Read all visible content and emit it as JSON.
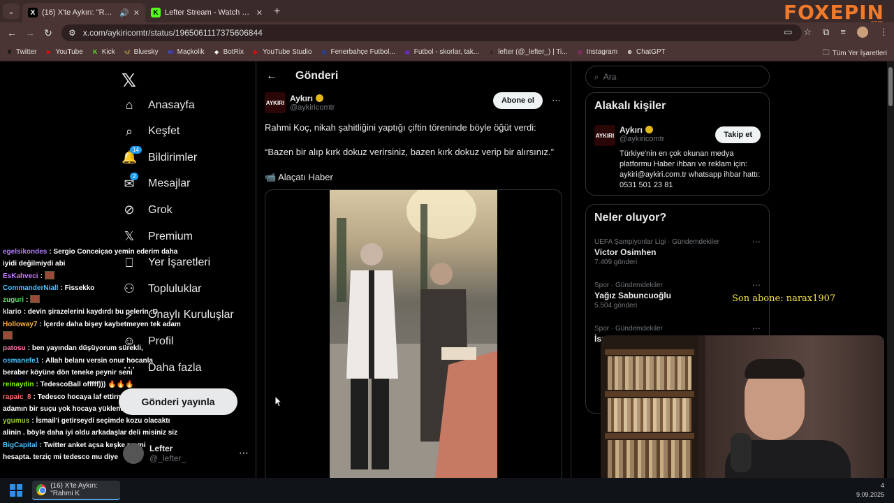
{
  "browser": {
    "tabs": [
      {
        "title": "(16) X'te Aykırı: \"Rahmi Koç",
        "favicon": "X",
        "active": true
      },
      {
        "title": "Lefter Stream - Watch Live on Kick",
        "favicon": "K",
        "active": false
      }
    ],
    "new_tab": "+",
    "url": "x.com/aykiricomtr/status/1965061117375606844",
    "brand": "FOXEPIN",
    "brand_sub": ".com",
    "bookmarks": [
      {
        "label": "Twitter",
        "icon": "X",
        "color": "#000000"
      },
      {
        "label": "YouTube",
        "icon": "▶",
        "color": "#ff0000"
      },
      {
        "label": "Kick",
        "icon": "K",
        "color": "#53fc18"
      },
      {
        "label": "Bluesky",
        "icon": "🦋",
        "color": "#1185fe"
      },
      {
        "label": "Maçkolik",
        "icon": "m",
        "color": "#3b5bdb"
      },
      {
        "label": "BotRix",
        "icon": "◆",
        "color": "#ffffff"
      },
      {
        "label": "YouTube Studio",
        "icon": "▶",
        "color": "#ff0000"
      },
      {
        "label": "Fenerbahçe Futbol...",
        "icon": "▦",
        "color": "#1e40af"
      },
      {
        "label": "Futbol - skorlar, tak...",
        "icon": "▣",
        "color": "#6d28d9"
      },
      {
        "label": "lefter (@_lefter_) | Ti...",
        "icon": "♪",
        "color": "#000000"
      },
      {
        "label": "Instagram",
        "icon": "◎",
        "color": "#d6249f"
      },
      {
        "label": "ChatGPT",
        "icon": "⊛",
        "color": "#ffffff"
      }
    ],
    "all_bookmarks": "Tüm Yer İşaretleri"
  },
  "nav": {
    "items": [
      {
        "label": "Anasayfa",
        "icon": "home-icon",
        "glyph": "⌂"
      },
      {
        "label": "Keşfet",
        "icon": "search-icon",
        "glyph": "⌕"
      },
      {
        "label": "Bildirimler",
        "icon": "bell-icon",
        "glyph": "🔔",
        "badge": "14"
      },
      {
        "label": "Mesajlar",
        "icon": "mail-icon",
        "glyph": "✉",
        "badge": "2"
      },
      {
        "label": "Grok",
        "icon": "grok-icon",
        "glyph": "⊘"
      },
      {
        "label": "Premium",
        "icon": "x-premium-icon",
        "glyph": "𝕏"
      },
      {
        "label": "Yer İşaretleri",
        "icon": "bookmark-icon",
        "glyph": "⎕"
      },
      {
        "label": "Topluluklar",
        "icon": "communities-icon",
        "glyph": "⚇"
      },
      {
        "label": "Onaylı Kuruluşlar",
        "icon": "verified-org-icon",
        "glyph": "⚡"
      },
      {
        "label": "Profil",
        "icon": "profile-icon",
        "glyph": "☺"
      },
      {
        "label": "Daha fazla",
        "icon": "more-icon",
        "glyph": "⋯"
      }
    ],
    "post_button": "Gönderi yayınla",
    "account_name": "Lefter",
    "account_handle": "@_lefter_"
  },
  "post": {
    "header": "Gönderi",
    "author_name": "Aykırı",
    "author_handle": "@aykiricomtr",
    "logo_text": "AYKIRI",
    "subscribe": "Abone ol",
    "text1": "Rahmi Koç, nikah şahitliğini yaptığı çiftin töreninde böyle öğüt verdi:",
    "text2": "“Bazen bir alıp kırk dokuz verirsiniz, bazen kırk dokuz verip bir alırsınız.”",
    "text3": "📹 Alaçatı Haber"
  },
  "sidebar": {
    "search_placeholder": "Ara",
    "related_title": "Alakalı kişiler",
    "related_name": "Aykırı",
    "related_handle": "@aykiricomtr",
    "follow": "Takip et",
    "related_bio": "Türkiye'nin en çok okunan medya platformu Haber ihbarı ve reklam için: aykiri@aykiri.com.tr whatsapp ihbar hattı: 0531 501 23 81",
    "trends_title": "Neler oluyor?",
    "trends": [
      {
        "context": "UEFA Şampiyonlar Ligi · Gündemdekiler",
        "name": "Victor Osimhen",
        "count": "7.409 gönderi"
      },
      {
        "context": "Spor · Gündemdekiler",
        "name": "Yağız Sabuncuoğlu",
        "count": "5.504 gönderi"
      },
      {
        "context": "Spor · Gündemdekiler",
        "name": "İsmail...",
        "count": ""
      }
    ]
  },
  "chat": [
    {
      "user": "egelsikondes",
      "color": "#b07cff",
      "msg": "Sergio Conceiçao yemin ederim daha"
    },
    {
      "user": "",
      "color": "#ffffff",
      "msg": "iyidi değilmiydi abi"
    },
    {
      "user": "EsKahveci",
      "color": "#c77dff",
      "msg": ""
    },
    {
      "user": "CommanderNiall",
      "color": "#4cc3ff",
      "msg": "Fissekko"
    },
    {
      "user": "zuguri",
      "color": "#5fe35f",
      "msg": ""
    },
    {
      "user": "klario",
      "color": "#e0e0e0",
      "msg": "devin şirazelerini kaydırdı bu pelerin :D"
    },
    {
      "user": "Holloway7",
      "color": "#ffb347",
      "msg": "İçerde daha bişey kaybetmeyen tek adam"
    },
    {
      "user": "",
      "color": "#ffffff",
      "msg": ""
    },
    {
      "user": "patosu",
      "color": "#ff77aa",
      "msg": "ben yayından düşüyorum sürekli,"
    },
    {
      "user": "osmanefe1",
      "color": "#4cc3ff",
      "msg": "Allah belanı versin onur hocanla"
    },
    {
      "user": "",
      "color": "#ffffff",
      "msg": "beraber köyüne dön teneke peynir seni"
    },
    {
      "user": "reinaydin",
      "color": "#7cfc00",
      "msg": "TedescoBall offfff))) 🔥🔥🔥"
    },
    {
      "user": "rapaic_8",
      "color": "#ff6b6b",
      "msg": "Tedesco hocaya laf ettirmeyecez, bu"
    },
    {
      "user": "",
      "color": "#ffffff",
      "msg": "adamın bir suçu yok hocaya yüklenmeyin"
    },
    {
      "user": "ygumus",
      "color": "#9acd32",
      "msg": "İsmail'i getirseydi seçimde kozu olacaktı"
    },
    {
      "user": "",
      "color": "#ffffff",
      "msg": "alinin . böyle daha iyi oldu arkadaşlar deli misiniz siz"
    },
    {
      "user": "BigCapital",
      "color": "#4cc3ff",
      "msg": "Twitter anket açsa keşke resmi"
    },
    {
      "user": "",
      "color": "#ffffff",
      "msg": "hesapta. terziç mi tedesco mu diye"
    }
  ],
  "overlay": {
    "sub_alert": "Son abone: narax1907"
  },
  "taskbar": {
    "app_title": "(16) X'te Aykırı: \"Rahmi K",
    "time": "4",
    "date": "9.09.2025"
  }
}
